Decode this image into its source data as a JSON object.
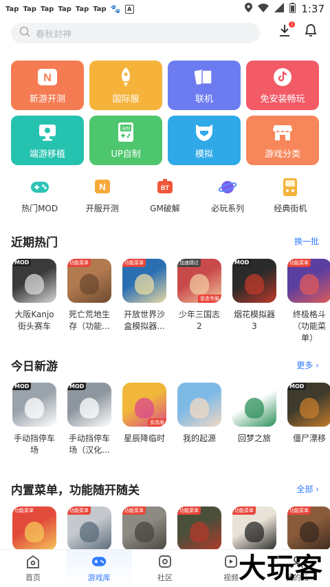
{
  "status_bar": {
    "apps": [
      "Tap",
      "Tap",
      "Tap",
      "Tap",
      "Tap",
      "Tap"
    ],
    "time": "1:37"
  },
  "search": {
    "placeholder": "春秋封神"
  },
  "download_badge": "1",
  "tiles": [
    {
      "label": "新游开测",
      "color": "#f47b52",
      "icon": "n-badge-icon"
    },
    {
      "label": "国际服",
      "color": "#f5b33c",
      "icon": "rocket-icon"
    },
    {
      "label": "联机",
      "color": "#6c7cf0",
      "icon": "cards-icon"
    },
    {
      "label": "免安装畅玩",
      "color": "#f25a66",
      "icon": "tiktok-icon"
    },
    {
      "label": "端游移植",
      "color": "#26c2b0",
      "icon": "monitor-icon"
    },
    {
      "label": "UP自制",
      "color": "#4ec66e",
      "icon": "gameboy-icon"
    },
    {
      "label": "模拟",
      "color": "#2fa9e8",
      "icon": "helmet-icon"
    },
    {
      "label": "游戏分类",
      "color": "#f7865a",
      "icon": "store-icon"
    }
  ],
  "shortcuts": [
    {
      "label": "热门MOD",
      "icon": "gamepad-icon"
    },
    {
      "label": "开服开测",
      "icon": "n-flag-icon"
    },
    {
      "label": "GM破解",
      "icon": "bt-icon"
    },
    {
      "label": "必玩系列",
      "icon": "planet-icon"
    },
    {
      "label": "经典街机",
      "icon": "arcade-icon"
    }
  ],
  "sections": [
    {
      "title": "近期热门",
      "more": "换一批",
      "games": [
        {
          "name": "大阪Kanjo街头赛车",
          "tag": "MOD",
          "tag_type": "mod",
          "color": "#3a3a3a",
          "accent": "#d7d7d7"
        },
        {
          "name": "死亡荒地生存（功能...",
          "tag": "功能菜单",
          "tag_type": "menu",
          "color": "#b27a4f",
          "accent": "#6d4a30"
        },
        {
          "name": "开放世界沙盒模拟器...",
          "tag": "功能菜单",
          "tag_type": "menu",
          "color": "#2b6fb3",
          "accent": "#e9d9a1"
        },
        {
          "name": "少年三国志2",
          "tag": "加速跳过",
          "tag_type": "speed",
          "color": "#c94a4a",
          "accent": "#f2c8a0",
          "sub": "变态专服"
        },
        {
          "name": "烟花模拟器3",
          "tag": "MOD",
          "tag_type": "mod",
          "color": "#2a2a2a",
          "accent": "#c0392b"
        },
        {
          "name": "终极格斗（功能菜单）",
          "tag": "功能菜单",
          "tag_type": "menu",
          "color": "#5b3fa0",
          "accent": "#e05a5a"
        }
      ]
    },
    {
      "title": "今日新游",
      "more": "更多 ›",
      "games": [
        {
          "name": "手动挡停车场",
          "tag": "MOD",
          "tag_type": "mod",
          "color": "#9aa3ab",
          "accent": "#ffffff"
        },
        {
          "name": "手动挡停车场（汉化...",
          "tag": "MOD",
          "tag_type": "mod",
          "color": "#8e979f",
          "accent": "#ffffff"
        },
        {
          "name": "星辰降临时",
          "tag": "",
          "tag_type": "",
          "color": "#f0b73a",
          "accent": "#d94a8c",
          "sub": "变态版"
        },
        {
          "name": "我的起源",
          "tag": "",
          "tag_type": "",
          "color": "#7fb9e6",
          "accent": "#f3d9c2"
        },
        {
          "name": "回梦之旅",
          "tag": "",
          "tag_type": "",
          "color": "#ffffff",
          "accent": "#2d8f5a"
        },
        {
          "name": "僵尸漂移",
          "tag": "MOD",
          "tag_type": "mod",
          "color": "#3e3a2c",
          "accent": "#c47c2b"
        }
      ]
    },
    {
      "title": "内置菜单，功能随开随关",
      "more": "全部 ›",
      "games": [
        {
          "name": "",
          "tag": "功能菜单",
          "tag_type": "menu",
          "color": "#e24b3b",
          "accent": "#f4c65a"
        },
        {
          "name": "",
          "tag": "功能菜单",
          "tag_type": "menu",
          "color": "#c5c9ce",
          "accent": "#5a6b7a"
        },
        {
          "name": "",
          "tag": "功能菜单",
          "tag_type": "menu",
          "color": "#8d8a83",
          "accent": "#4a4640"
        },
        {
          "name": "",
          "tag": "功能菜单",
          "tag_type": "menu",
          "color": "#4a4f3a",
          "accent": "#b23a2a"
        },
        {
          "name": "",
          "tag": "功能菜单",
          "tag_type": "menu",
          "color": "#e9e2d6",
          "accent": "#2a2a2a"
        },
        {
          "name": "",
          "tag": "功能菜单",
          "tag_type": "menu",
          "color": "#8a5b3a",
          "accent": "#3a2a20"
        }
      ]
    }
  ],
  "bottom_nav": [
    {
      "label": "首页",
      "icon": "home-icon",
      "active": false
    },
    {
      "label": "游戏库",
      "icon": "gamepad-icon",
      "active": true
    },
    {
      "label": "社区",
      "icon": "community-icon",
      "active": false
    },
    {
      "label": "视频",
      "icon": "video-icon",
      "active": false
    },
    {
      "label": "我的元",
      "icon": "profile-icon",
      "active": false
    }
  ],
  "watermark": "大玩客"
}
